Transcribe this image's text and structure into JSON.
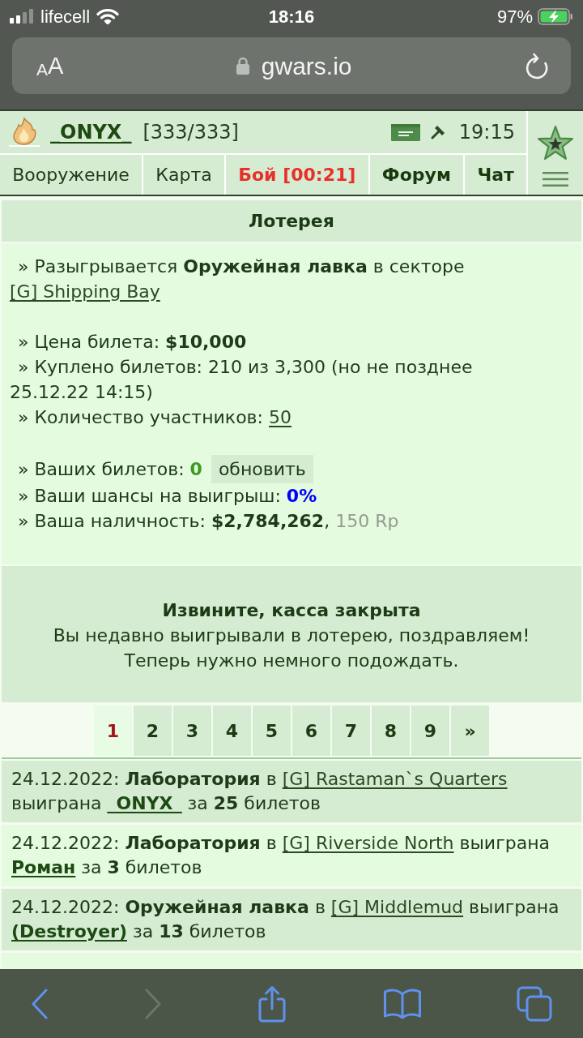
{
  "status_bar": {
    "carrier": "lifecell",
    "time": "18:16",
    "battery": "97%"
  },
  "browser": {
    "text_size": "AA",
    "address": "gwars.io"
  },
  "header": {
    "player": "_ONYX_",
    "health": "[333/333]",
    "clock": "19:15",
    "nav": [
      {
        "label": "Вооружение",
        "kind": "plain"
      },
      {
        "label": "Карта",
        "kind": "plain"
      },
      {
        "label": "Бой [00:21]",
        "kind": "alert"
      },
      {
        "label": "Форум",
        "kind": "strong"
      },
      {
        "label": "Чат",
        "kind": "strong"
      }
    ]
  },
  "lottery": {
    "title": "Лотерея",
    "groups": [
      [
        {
          "parts": [
            {
              "kind": "text",
              "text": "» Разыгрывается **Оружейная лавка** в секторе"
            },
            {
              "kind": "link",
              "text": "[G] Shipping Bay"
            }
          ]
        }
      ],
      [
        {
          "parts": [
            {
              "kind": "text",
              "text": "» Цена билета: **$10,000**"
            }
          ]
        },
        {
          "parts": [
            {
              "kind": "text",
              "text": "» Куплено билетов: 210 из 3,300 (но не позднее 25.12.22 14:15)"
            }
          ]
        },
        {
          "parts": [
            {
              "kind": "text",
              "text": "» Количество участников:"
            },
            {
              "kind": "link",
              "text": "50"
            }
          ]
        }
      ],
      [
        {
          "parts": [
            {
              "kind": "text",
              "text": "» Ваших билетов:"
            },
            {
              "kind": "value",
              "text": "0",
              "color": "#3f9a22"
            },
            {
              "kind": "button",
              "text": "обновить"
            }
          ]
        },
        {
          "parts": [
            {
              "kind": "text",
              "text": "» Ваши шансы на выигрыш:"
            },
            {
              "kind": "value",
              "text": "0%",
              "color": "#0000ff"
            }
          ]
        },
        {
          "parts": [
            {
              "kind": "text",
              "text": "» Ваша наличность: **$2,784,262**,"
            },
            {
              "kind": "note",
              "text": "150 Rp"
            }
          ]
        }
      ]
    ]
  },
  "notice": {
    "title": "Извините, касса закрыта",
    "lines": [
      "Вы недавно выигрывали в лотерею, поздравляем!",
      "Теперь нужно немного подождать."
    ]
  },
  "pagination": {
    "pages": [
      {
        "label": "1",
        "selected": true
      },
      {
        "label": "2",
        "selected": false
      },
      {
        "label": "3",
        "selected": false
      },
      {
        "label": "4",
        "selected": false
      },
      {
        "label": "5",
        "selected": false
      },
      {
        "label": "6",
        "selected": false
      },
      {
        "label": "7",
        "selected": false
      },
      {
        "label": "8",
        "selected": false
      },
      {
        "label": "9",
        "selected": false
      }
    ],
    "next": "»"
  },
  "history": [
    {
      "parts": [
        {
          "kind": "text",
          "text": "24.12.2022: **Лаборатория** в"
        },
        {
          "kind": "link",
          "text": "[G] Rastaman`s Quarters"
        },
        {
          "kind": "text",
          "text": "выиграна"
        },
        {
          "kind": "player",
          "text": "_ONYX_"
        },
        {
          "kind": "text",
          "text": "за **25** билетов"
        }
      ]
    },
    {
      "parts": [
        {
          "kind": "text",
          "text": "24.12.2022: **Лаборатория** в"
        },
        {
          "kind": "link",
          "text": "[G] Riverside North"
        },
        {
          "kind": "text",
          "text": "выиграна"
        },
        {
          "kind": "player",
          "text": "Роман"
        },
        {
          "kind": "text",
          "text": "за **3** билетов"
        }
      ]
    },
    {
      "parts": [
        {
          "kind": "text",
          "text": "24.12.2022: **Оружейная лавка** в"
        },
        {
          "kind": "link",
          "text": "[G] Middlemud"
        },
        {
          "kind": "text",
          "text": "выиграна"
        },
        {
          "kind": "player",
          "text": "(Destroyer)"
        },
        {
          "kind": "text",
          "text": "за **13** билетов"
        }
      ]
    }
  ],
  "toolbar": [
    {
      "kind": "back",
      "disabled": false
    },
    {
      "kind": "forward",
      "disabled": true
    },
    {
      "kind": "share",
      "disabled": false
    },
    {
      "kind": "bookmarks",
      "disabled": false
    },
    {
      "kind": "tabs",
      "disabled": false
    }
  ]
}
